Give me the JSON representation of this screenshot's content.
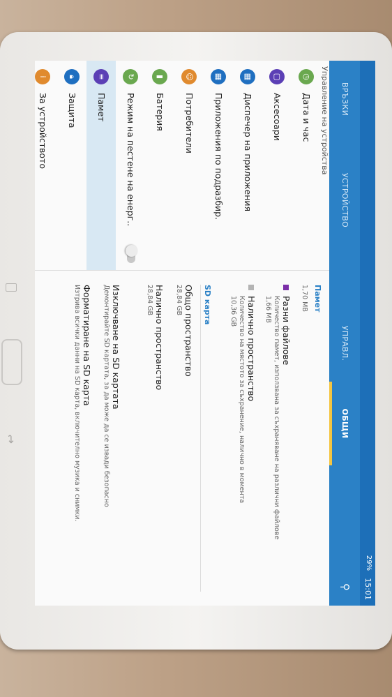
{
  "statusbar": {
    "time": "15:01",
    "signal": "29%"
  },
  "tabs": [
    {
      "label": "ВРЪЗКИ",
      "active": false
    },
    {
      "label": "УСТРОЙСТВО",
      "active": false
    },
    {
      "label": "УПРАВЛ.",
      "active": false
    },
    {
      "label": "ОБЩИ",
      "active": true
    }
  ],
  "left": {
    "section": "Управление на устройства",
    "items": [
      {
        "label": "Дата и час",
        "icon": "clock-icon",
        "color": "#6aa84f"
      },
      {
        "label": "Аксесоари",
        "icon": "accessory-icon",
        "color": "#5b3fb5"
      },
      {
        "label": "Диспечер на приложения",
        "icon": "apps-icon",
        "color": "#1f6fc0"
      },
      {
        "label": "Приложения по подразбир.",
        "icon": "default-apps-icon",
        "color": "#1f6fc0"
      },
      {
        "label": "Потребители",
        "icon": "users-icon",
        "color": "#e08a2e"
      },
      {
        "label": "Батерия",
        "icon": "battery-icon",
        "color": "#6aa84f"
      },
      {
        "label": "Режим на пестене на енерг..",
        "icon": "power-saving-icon",
        "color": "#6aa84f"
      },
      {
        "label": "Памет",
        "icon": "storage-icon",
        "color": "#5b3fb5"
      },
      {
        "label": "Защита",
        "icon": "lock-icon",
        "color": "#1f6fc0"
      },
      {
        "label": "За устройството",
        "icon": "info-icon",
        "color": "#e08a2e"
      }
    ]
  },
  "right": {
    "memory_header": "Памет",
    "memory_top_value": "1,70 MB",
    "misc_files": {
      "title": "Разни файлове",
      "desc": "Количество памет, използвана за съхраняване на различни файлове",
      "value": "1,66 MB",
      "color": "#7b2fa8"
    },
    "available": {
      "title": "Налично пространство",
      "desc": "Количество на мястото за съхранение, налично в момента",
      "value": "10,36 GB",
      "color": "#b4b4b4"
    },
    "sd_header": "SD карта",
    "sd_total": {
      "title": "Общо пространство",
      "value": "28,84 GB"
    },
    "sd_available": {
      "title": "Налично пространство",
      "value": "28,84 GB"
    },
    "unmount": {
      "title": "Изключване на SD картата",
      "desc": "Демонтирайте SD картата, за да може да се извади безопасно"
    },
    "format": {
      "title": "Форматиране на SD карта",
      "desc": "Изтрива всички данни на SD карта, включително музика и снимки."
    }
  }
}
